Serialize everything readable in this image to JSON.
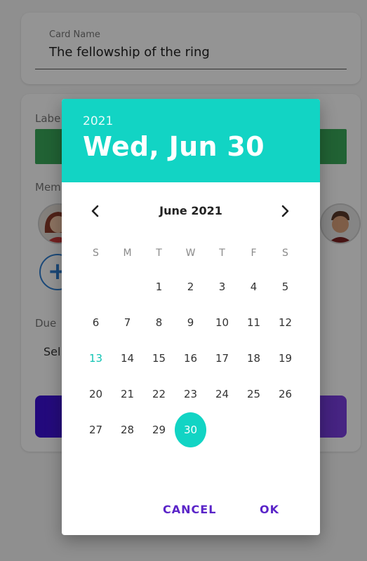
{
  "background": {
    "card_name_label": "Card Name",
    "card_name_value": "The fellowship of the ring",
    "label_section_partial": "Labe",
    "members_section_partial": "Mem",
    "due_section_partial": "Due",
    "select_partial": "Sel",
    "label_color": "#3aa95a",
    "button_colors": [
      "#3b10d6",
      "#7b3fe0"
    ]
  },
  "dialog": {
    "header": {
      "year": "2021",
      "date": "Wed, Jun 30",
      "color": "#12d4c4"
    },
    "nav": {
      "month_label": "June 2021",
      "prev_icon": "chevron-left-icon",
      "next_icon": "chevron-right-icon"
    },
    "weekdays": [
      "S",
      "M",
      "T",
      "W",
      "T",
      "F",
      "S"
    ],
    "weeks": [
      [
        "",
        "",
        "1",
        "2",
        "3",
        "4",
        "5"
      ],
      [
        "6",
        "7",
        "8",
        "9",
        "10",
        "11",
        "12"
      ],
      [
        "13",
        "14",
        "15",
        "16",
        "17",
        "18",
        "19"
      ],
      [
        "20",
        "21",
        "22",
        "23",
        "24",
        "25",
        "26"
      ],
      [
        "27",
        "28",
        "29",
        "30",
        "",
        "",
        ""
      ]
    ],
    "today": "13",
    "selected": "30",
    "actions": {
      "cancel": "CANCEL",
      "ok": "OK"
    }
  }
}
